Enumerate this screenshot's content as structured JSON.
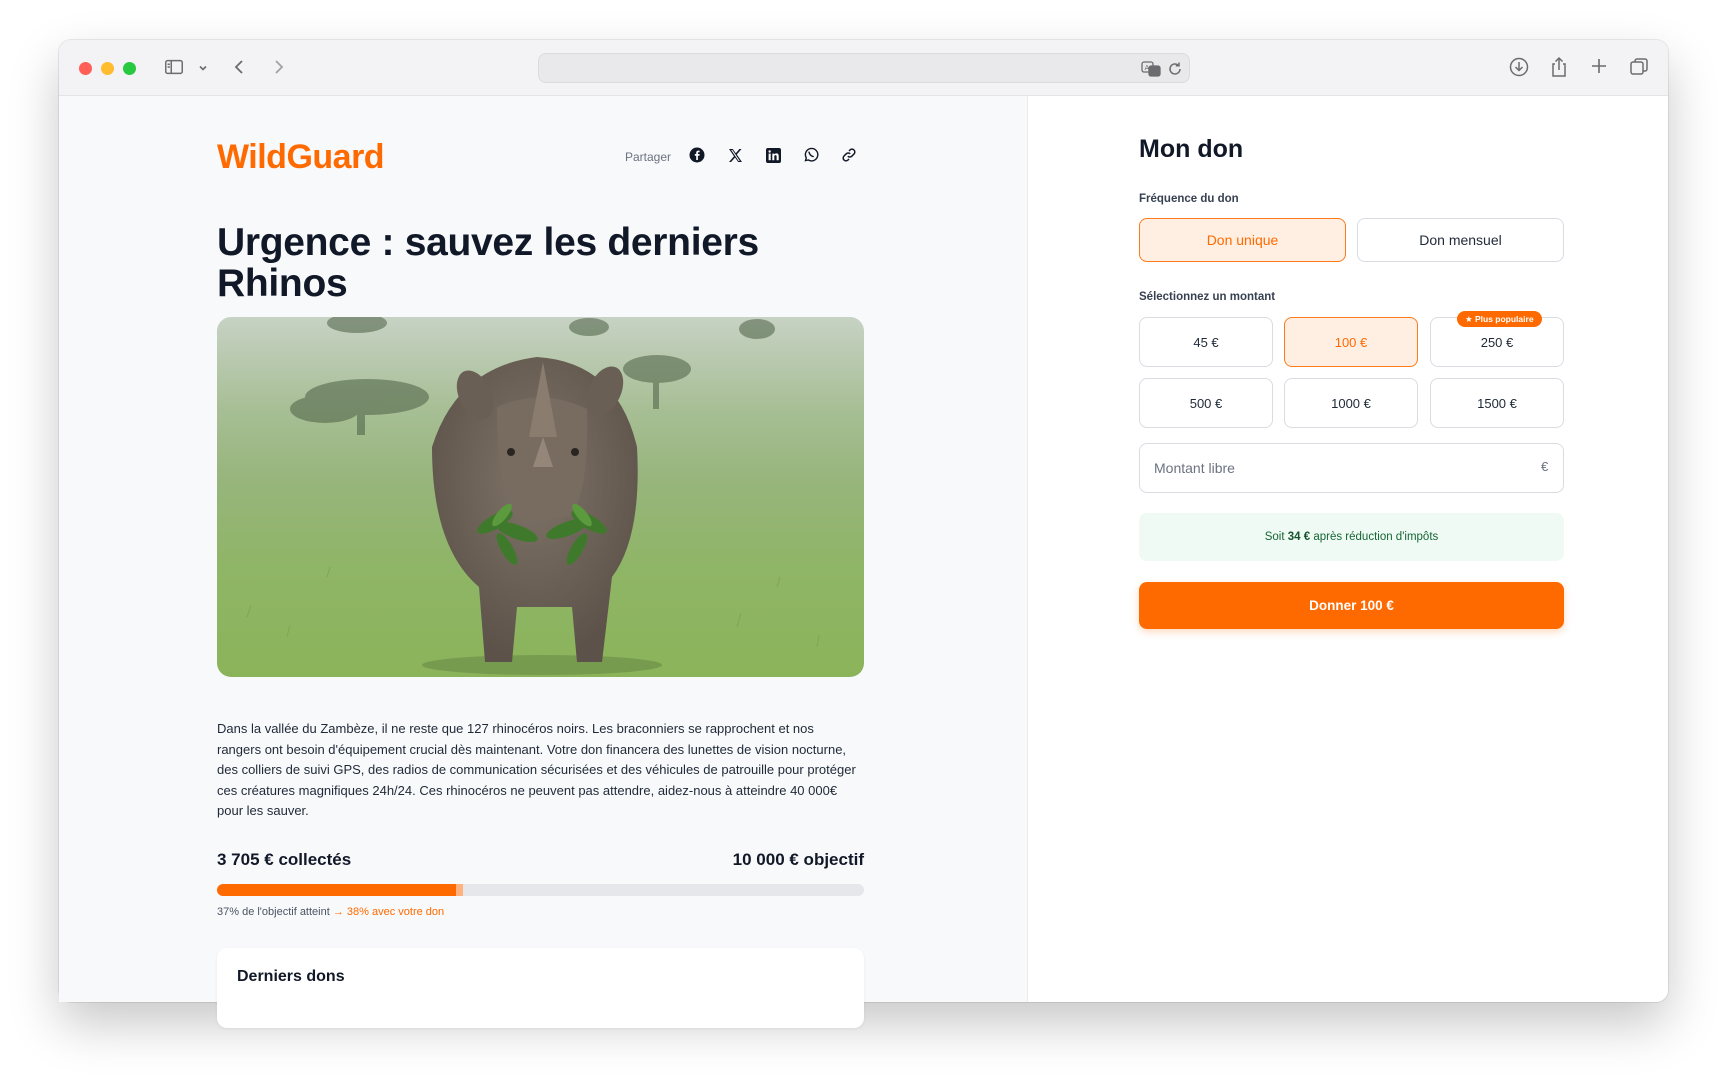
{
  "brand": {
    "name": "WildGuard"
  },
  "share": {
    "label": "Partager",
    "buttons": [
      "facebook-icon",
      "x-icon",
      "linkedin-icon",
      "whatsapp-icon",
      "link-icon"
    ]
  },
  "campaign": {
    "title": "Urgence : sauvez les derniers Rhinos",
    "description": "Dans la vallée du Zambèze, il ne reste que 127 rhinocéros noirs. Les braconniers se rapprochent et nos rangers ont besoin d'équipement crucial dès maintenant. Votre don financera des lunettes de vision nocturne, des colliers de suivi GPS, des radios de communication sécurisées et des véhicules de patrouille pour protéger ces créatures magnifiques 24h/24. Ces rhinocéros ne peuvent pas attendre, aidez-nous à atteindre 40 000€ pour les sauver.",
    "raised_label": "3 705 € collectés",
    "goal_label": "10 000 € objectif",
    "progress_fraction": 0.37,
    "progress_with_donation_fraction": 0.38,
    "progress_note": "37% de l'objectif atteint",
    "progress_note_highlight": "→ 38% avec votre don"
  },
  "recent": {
    "title": "Derniers dons"
  },
  "donation": {
    "title": "Mon don",
    "frequency_label": "Fréquence du don",
    "frequency_options": [
      "Don unique",
      "Don mensuel"
    ],
    "frequency_selected": "Don unique",
    "amount_label": "Sélectionnez un montant",
    "amounts": [
      "45 €",
      "100 €",
      "250 €",
      "500 €",
      "1000 €",
      "1500 €"
    ],
    "amount_selected": "100 €",
    "popular_badge": "★ Plus populaire",
    "free_amount_placeholder": "Montant libre",
    "currency_suffix": "€",
    "tax_prefix": "Soit",
    "tax_amount": "34 €",
    "tax_suffix": "après réduction d'impôts",
    "submit_label": "Donner 100 €"
  },
  "colors": {
    "accent": "#ff6a00",
    "accent_light": "#ffefe3",
    "success_bg": "#eefaf3",
    "text": "#111827"
  }
}
